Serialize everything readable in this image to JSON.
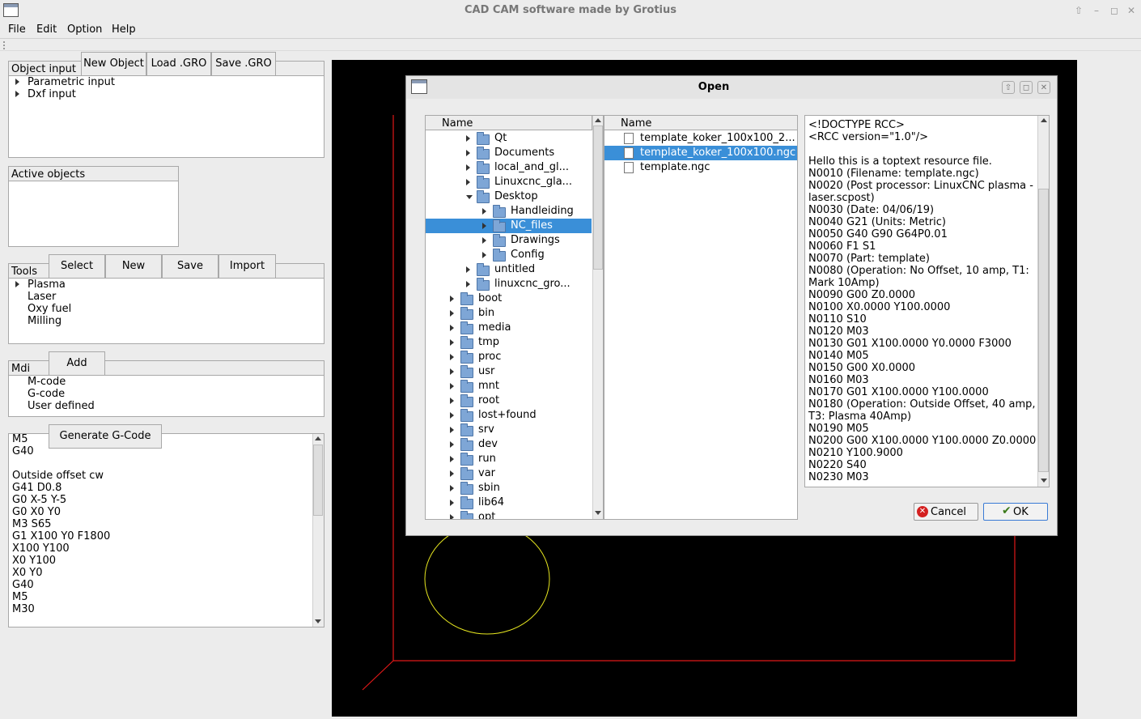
{
  "window": {
    "title": "CAD CAM software made by Grotius"
  },
  "menu": [
    "File",
    "Edit",
    "Option",
    "Help"
  ],
  "object_input": {
    "tab": "Object input",
    "buttons": [
      "New Object",
      "Load .GRO",
      "Save .GRO"
    ],
    "items": [
      "Parametric input",
      "Dxf input"
    ]
  },
  "active_objects": {
    "tab": "Active objects"
  },
  "tools": {
    "tab": "Tools",
    "buttons": [
      "Select",
      "New",
      "Save",
      "Import"
    ],
    "items": [
      "Plasma",
      "Laser",
      "Oxy fuel",
      "Milling"
    ]
  },
  "mdi": {
    "tab": "Mdi",
    "button": "Add",
    "items": [
      "M-code",
      "G-code",
      "User defined"
    ]
  },
  "gcode": {
    "button": "Generate G-Code",
    "lines": [
      "M5",
      "G40",
      "",
      "Outside offset cw",
      "G41 D0.8",
      "G0 X-5 Y-5",
      "G0 X0 Y0",
      "M3 S65",
      "G1 X100 Y0 F1800",
      "X100 Y100",
      "X0 Y100",
      "X0 Y0",
      "G40",
      "M5",
      "M30"
    ]
  },
  "dialog": {
    "title": "Open",
    "dir_header": "Name",
    "file_header": "Name",
    "dirs": [
      {
        "name": "Qt",
        "level": 2,
        "arrow": "right"
      },
      {
        "name": "Documents",
        "level": 2,
        "arrow": "right"
      },
      {
        "name": "local_and_gl...",
        "level": 2,
        "arrow": "right"
      },
      {
        "name": "Linuxcnc_gla...",
        "level": 2,
        "arrow": "right"
      },
      {
        "name": "Desktop",
        "level": 2,
        "arrow": "down"
      },
      {
        "name": "Handleiding",
        "level": 3,
        "arrow": "right"
      },
      {
        "name": "NC_files",
        "level": 3,
        "arrow": "right",
        "selected": true
      },
      {
        "name": "Drawings",
        "level": 3,
        "arrow": "right"
      },
      {
        "name": "Config",
        "level": 3,
        "arrow": "right"
      },
      {
        "name": "untitled",
        "level": 2,
        "arrow": "right"
      },
      {
        "name": "linuxcnc_gro...",
        "level": 2,
        "arrow": "right"
      },
      {
        "name": "boot",
        "level": 1,
        "arrow": "right"
      },
      {
        "name": "bin",
        "level": 1,
        "arrow": "right"
      },
      {
        "name": "media",
        "level": 1,
        "arrow": "right"
      },
      {
        "name": "tmp",
        "level": 1,
        "arrow": "right"
      },
      {
        "name": "proc",
        "level": 1,
        "arrow": "right"
      },
      {
        "name": "usr",
        "level": 1,
        "arrow": "right"
      },
      {
        "name": "mnt",
        "level": 1,
        "arrow": "right"
      },
      {
        "name": "root",
        "level": 1,
        "arrow": "right"
      },
      {
        "name": "lost+found",
        "level": 1,
        "arrow": "right"
      },
      {
        "name": "srv",
        "level": 1,
        "arrow": "right"
      },
      {
        "name": "dev",
        "level": 1,
        "arrow": "right"
      },
      {
        "name": "run",
        "level": 1,
        "arrow": "right"
      },
      {
        "name": "var",
        "level": 1,
        "arrow": "right"
      },
      {
        "name": "sbin",
        "level": 1,
        "arrow": "right"
      },
      {
        "name": "lib64",
        "level": 1,
        "arrow": "right"
      },
      {
        "name": "opt",
        "level": 1,
        "arrow": "right"
      }
    ],
    "files": [
      {
        "name": "template_koker_100x100_2..."
      },
      {
        "name": "template_koker_100x100.ngc",
        "selected": true
      },
      {
        "name": "template.ngc"
      }
    ],
    "preview": [
      "<!DOCTYPE RCC>",
      "<RCC version=\"1.0\"/>",
      "",
      "Hello this is a toptext resource file.",
      "N0010 (Filename: template.ngc)",
      "N0020 (Post processor: LinuxCNC plasma -",
      "laser.scpost)",
      "N0030 (Date: 04/06/19)",
      "N0040 G21 (Units: Metric)",
      "N0050 G40 G90 G64P0.01",
      "N0060 F1 S1",
      "N0070 (Part: template)",
      "N0080 (Operation: No Offset, 10 amp, T1:",
      "Mark 10Amp)",
      "N0090 G00 Z0.0000",
      "N0100 X0.0000 Y100.0000",
      "N0110 S10",
      "N0120 M03",
      "N0130 G01 X100.0000 Y0.0000 F3000",
      "N0140 M05",
      "N0150 G00 X0.0000",
      "N0160 M03",
      "N0170 G01 X100.0000 Y100.0000",
      "N0180 (Operation: Outside Offset, 40 amp,",
      "T3: Plasma 40Amp)",
      "N0190 M05",
      "N0200 G00 X100.0000 Y100.0000 Z0.0000",
      "N0210 Y100.9000",
      "N0220 S40",
      "N0230 M03"
    ],
    "cancel": "Cancel",
    "ok": "OK"
  }
}
